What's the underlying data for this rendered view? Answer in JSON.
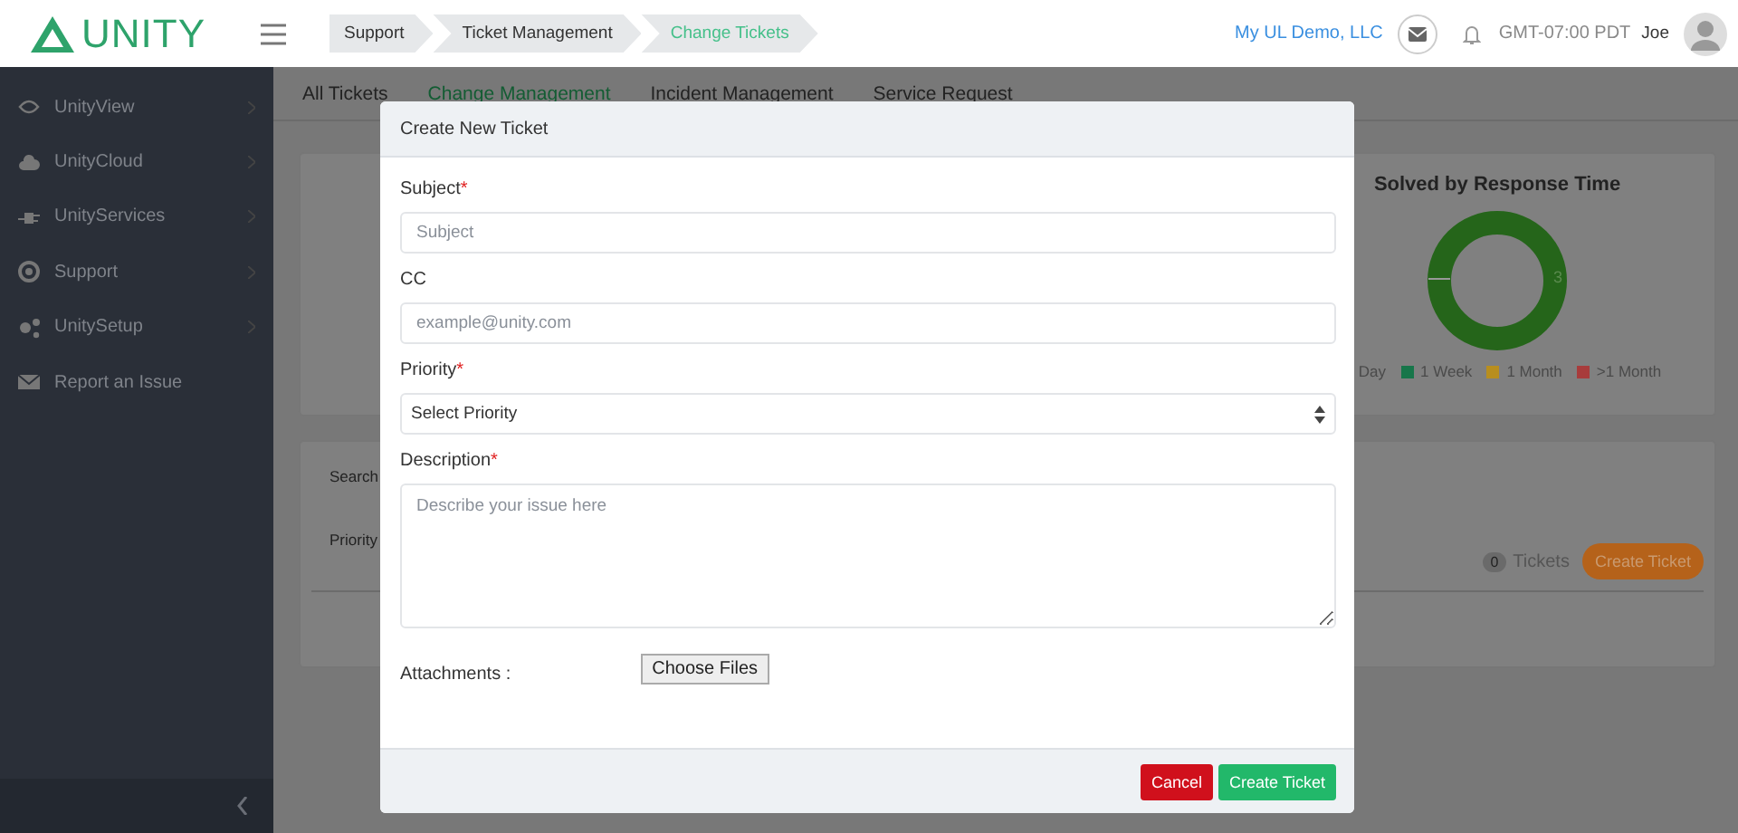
{
  "header": {
    "logo": "UNITY",
    "breadcrumbs": [
      {
        "label": "Support",
        "selected": false
      },
      {
        "label": "Ticket Management",
        "selected": false
      },
      {
        "label": "Change Tickets",
        "selected": true
      }
    ],
    "company": "My UL Demo, LLC",
    "timezone": "GMT-07:00 PDT",
    "user": "Joe"
  },
  "sidebar": {
    "items": [
      {
        "label": "UnityView",
        "expandable": true
      },
      {
        "label": "UnityCloud",
        "expandable": true
      },
      {
        "label": "UnityServices",
        "expandable": true
      },
      {
        "label": "Support",
        "expandable": true
      },
      {
        "label": "UnitySetup",
        "expandable": true
      },
      {
        "label": "Report an Issue",
        "expandable": false
      }
    ]
  },
  "tabs": [
    {
      "label": "All Tickets",
      "selected": false
    },
    {
      "label": "Change Management",
      "selected": true
    },
    {
      "label": "Incident Management",
      "selected": false
    },
    {
      "label": "Service Request",
      "selected": false
    }
  ],
  "chart_card": {
    "title": "Solved by Response Time",
    "center_label": "3",
    "legend": [
      {
        "label": "Day"
      },
      {
        "label": "1 Week",
        "color": "#17764a"
      },
      {
        "label": "1 Month",
        "color": "#b88e1e"
      },
      {
        "label": ">1 Month",
        "color": "#a83c3c"
      }
    ]
  },
  "filters": {
    "labels": [
      "Search",
      "Priority"
    ],
    "count": "0",
    "count_label": "Tickets",
    "button": "Create Ticket"
  },
  "modal": {
    "title": "Create New Ticket",
    "required_mark": "*",
    "fields": [
      {
        "kind": "text",
        "label": "Subject",
        "required": true,
        "placeholder": "Subject"
      },
      {
        "kind": "text",
        "label": "CC",
        "required": false,
        "placeholder": "example@unity.com"
      },
      {
        "kind": "select",
        "label": "Priority",
        "required": true,
        "value": "Select Priority"
      },
      {
        "kind": "textarea",
        "label": "Description",
        "required": true,
        "placeholder": "Describe your issue here"
      },
      {
        "kind": "file",
        "label": "Attachments :",
        "required": false,
        "button": "Choose Files"
      }
    ],
    "buttons": [
      {
        "kind": "cancel",
        "label": "Cancel"
      },
      {
        "kind": "submit",
        "label": "Create Ticket"
      }
    ]
  }
}
